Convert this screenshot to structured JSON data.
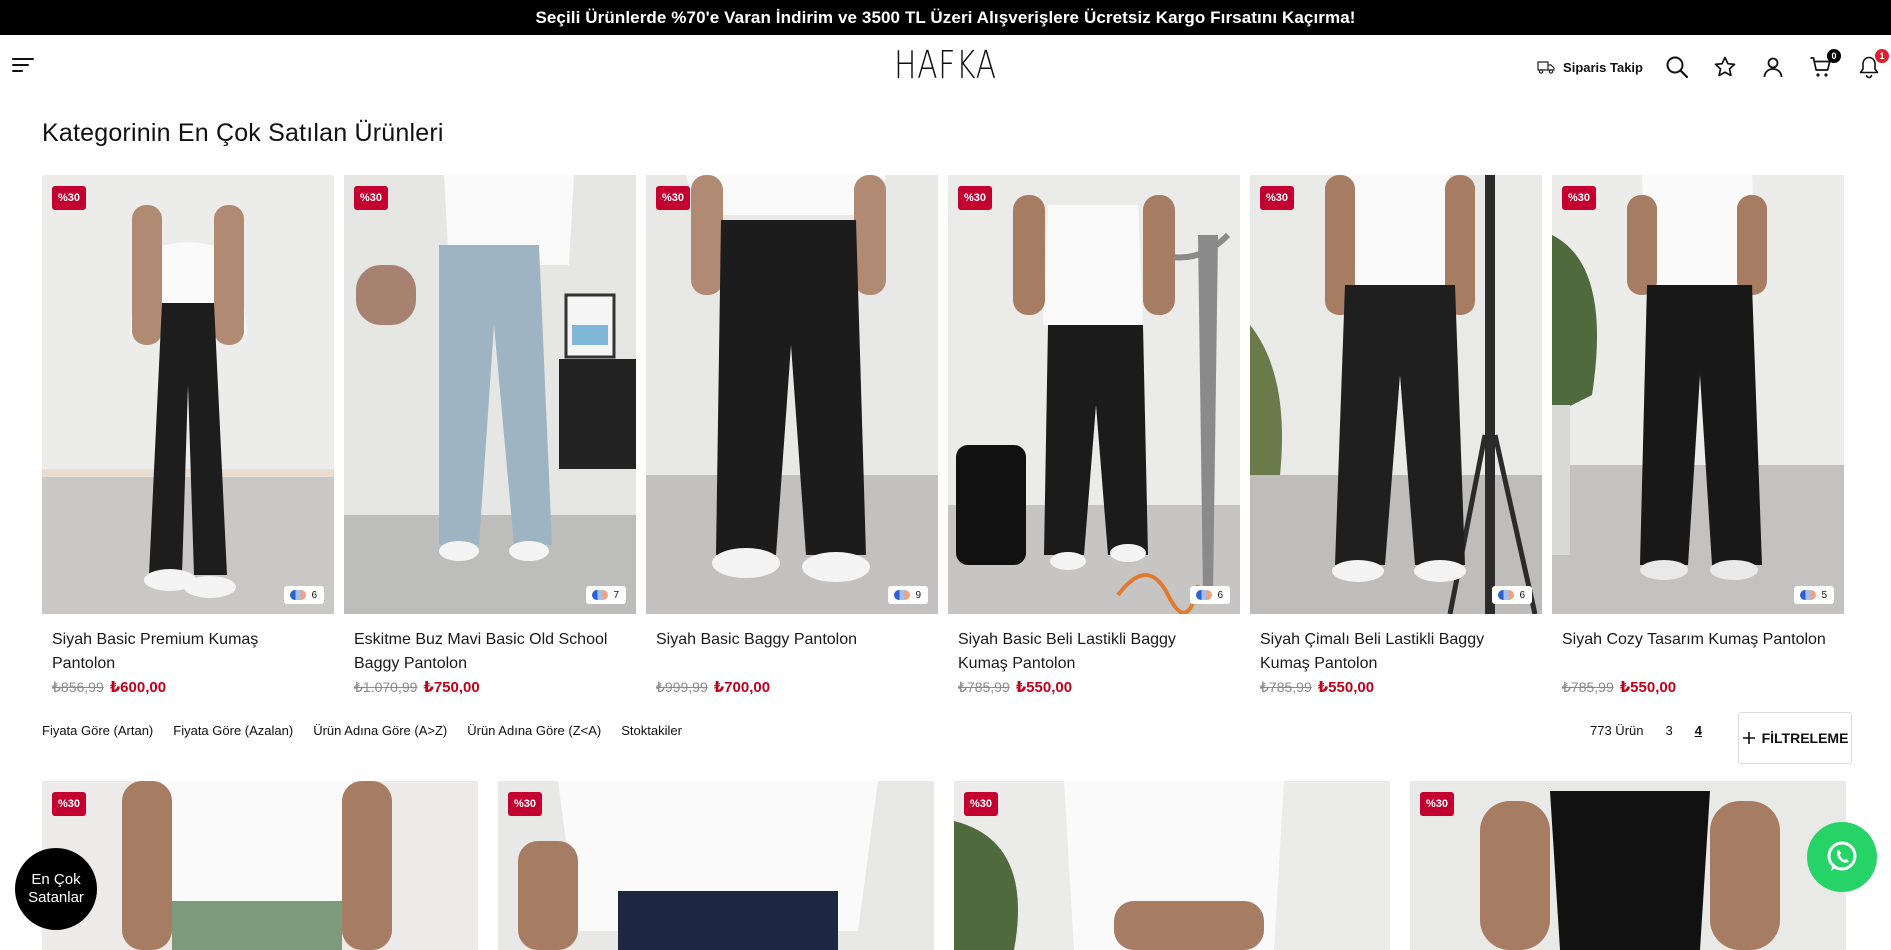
{
  "announcement": "Seçili Ürünlerde %70'e Varan İndirim ve 3500 TL Üzeri Alışverişlere Ücretsiz Kargo Fırsatını Kaçırma!",
  "header": {
    "logo": "HAFKA",
    "order_tracking": "Siparis Takip",
    "cart_count": "0",
    "notification_count": "1"
  },
  "section_title": "Kategorinin En Çok Satılan Ürünleri",
  "bestsellers": [
    {
      "discount": "%30",
      "colors": "6",
      "name": "Siyah Basic Premium Kumaş Pantolon",
      "old_price": "₺856,99",
      "price": "₺600,00"
    },
    {
      "discount": "%30",
      "colors": "7",
      "name": "Eskitme Buz Mavi Basic Old School Baggy Pantolon",
      "old_price": "₺1.070,99",
      "price": "₺750,00"
    },
    {
      "discount": "%30",
      "colors": "9",
      "name": "Siyah Basic Baggy Pantolon",
      "old_price": "₺999,99",
      "price": "₺700,00"
    },
    {
      "discount": "%30",
      "colors": "6",
      "name": "Siyah Basic Beli Lastikli Baggy Kumaş Pantolon",
      "old_price": "₺785,99",
      "price": "₺550,00"
    },
    {
      "discount": "%30",
      "colors": "6",
      "name": "Siyah Çimalı Beli Lastikli Baggy Kumaş Pantolon",
      "old_price": "₺785,99",
      "price": "₺550,00"
    },
    {
      "discount": "%30",
      "colors": "5",
      "name": "Siyah Cozy Tasarım Kumaş Pantolon",
      "old_price": "₺785,99",
      "price": "₺550,00"
    }
  ],
  "sort_options": [
    "Fiyata Göre (Artan)",
    "Fiyata Göre (Azalan)",
    "Ürün Adına Göre (A>Z)",
    "Ürün Adına Göre (Z<A)",
    "Stoktakiler"
  ],
  "product_count": "773 Ürün",
  "grid_options": [
    "3",
    "4"
  ],
  "filter_label": "FİLTRELEME",
  "listing": [
    {
      "discount": "%30"
    },
    {
      "discount": "%30"
    },
    {
      "discount": "%30"
    },
    {
      "discount": "%30"
    }
  ],
  "bestseller_button": "En Çok Satanlar",
  "colors": {
    "discount_badge": "#c3002f",
    "sale_price": "#c3001a",
    "whatsapp": "#25d366",
    "announcement_bg": "#000000"
  }
}
